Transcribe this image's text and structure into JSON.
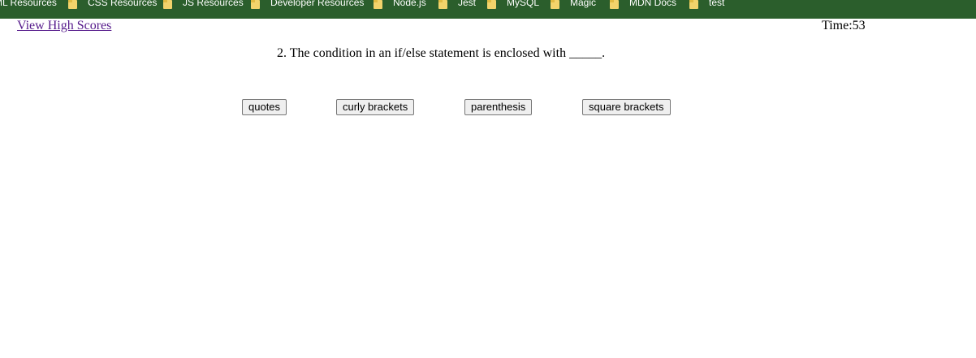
{
  "bookmarks_bar": {
    "items": [
      {
        "label": "HTML Resources",
        "icon": "folder-icon"
      },
      {
        "label": "CSS Resources",
        "icon": "folder-icon"
      },
      {
        "label": "JS Resources",
        "icon": "folder-icon"
      },
      {
        "label": "Developer Resources",
        "icon": "folder-icon"
      },
      {
        "label": "Node.js",
        "icon": "folder-icon"
      },
      {
        "label": "Jest",
        "icon": "folder-icon"
      },
      {
        "label": "MySQL",
        "icon": "folder-icon"
      },
      {
        "label": "Magic",
        "icon": "folder-icon"
      },
      {
        "label": "MDN Docs",
        "icon": "folder-icon"
      },
      {
        "label": "test",
        "icon": "folder-icon"
      }
    ],
    "background_color": "#2b5e2c"
  },
  "header": {
    "high_scores_link": "View High Scores",
    "timer_text": "Time:53"
  },
  "quiz": {
    "question": "2. The condition in an if/else statement is enclosed with _____.",
    "answers": [
      "quotes",
      "curly brackets",
      "parenthesis",
      "square brackets"
    ]
  }
}
